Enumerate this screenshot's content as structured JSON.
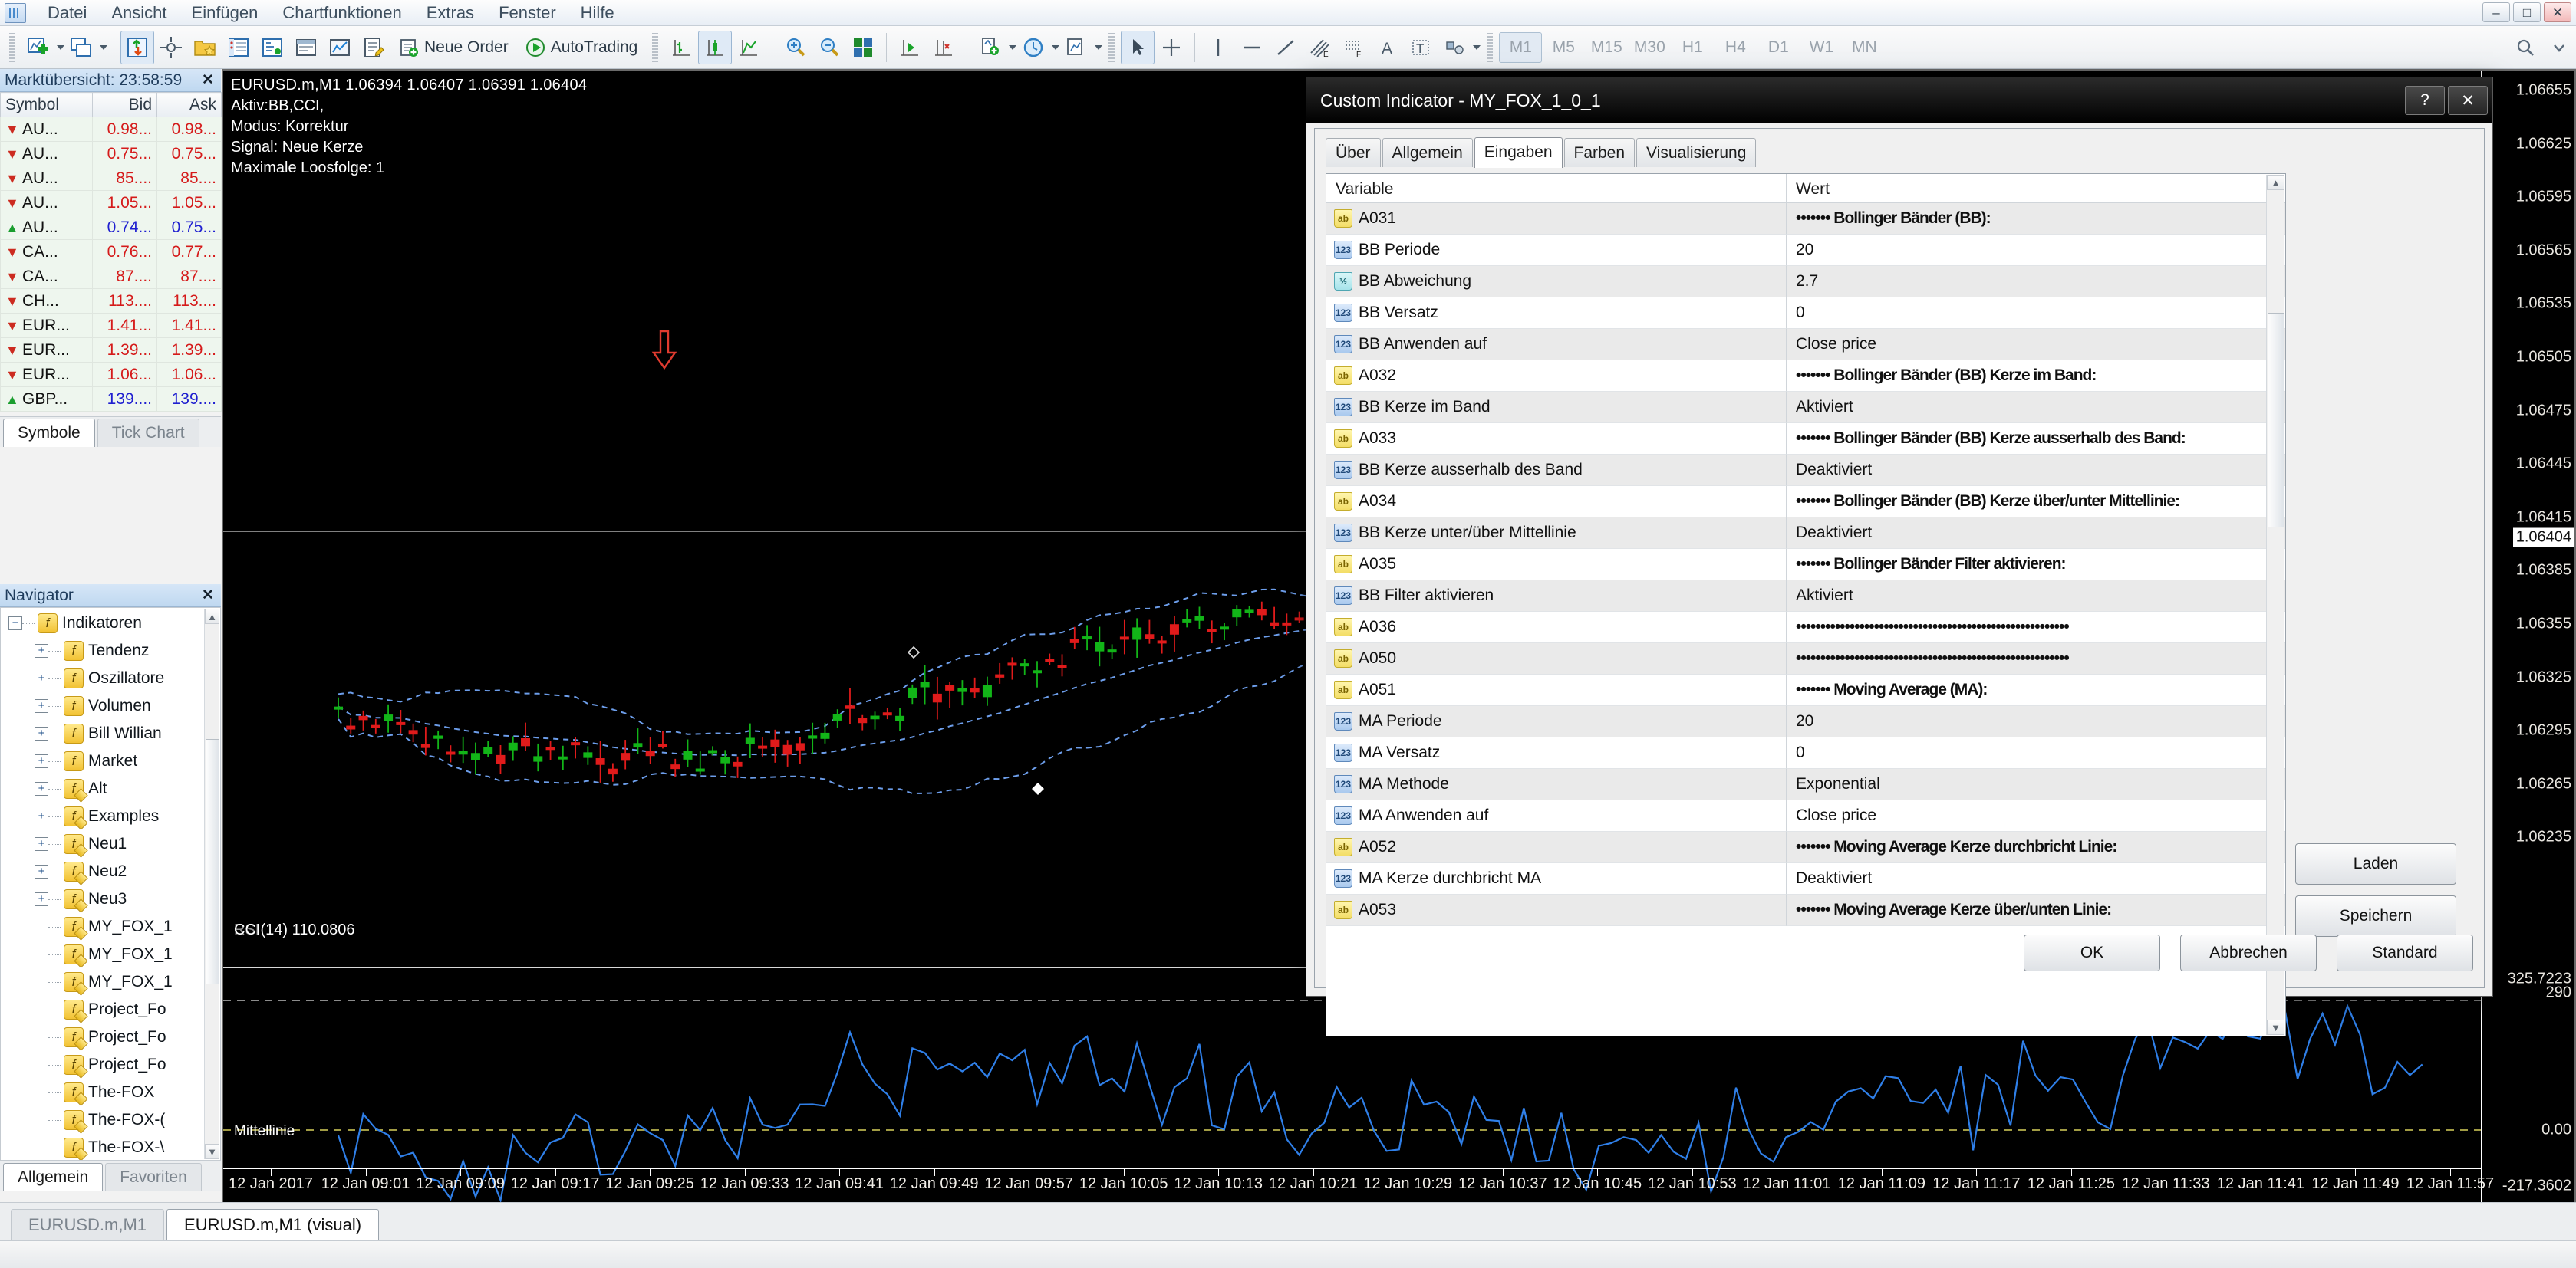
{
  "app": {
    "logo_icon": "metatrader-logo-icon",
    "menu": [
      "Datei",
      "Ansicht",
      "Einfügen",
      "Chartfunktionen",
      "Extras",
      "Fenster",
      "Hilfe"
    ],
    "window_buttons": [
      {
        "name": "minimize-button",
        "glyph": "–"
      },
      {
        "name": "maximize-button",
        "glyph": "□"
      },
      {
        "name": "close-button",
        "glyph": "✕"
      }
    ]
  },
  "toolbar": {
    "new_order_label": "Neue Order",
    "autotrading_label": "AutoTrading",
    "timeframes": [
      "M1",
      "M5",
      "M15",
      "M30",
      "H1",
      "H4",
      "D1",
      "W1",
      "MN"
    ],
    "active_timeframe": "M1",
    "icons": [
      "new-chart-icon",
      "chart-window-icon",
      "market-watch-icon",
      "crosshair-icon",
      "favorites-folder-icon",
      "data-window-icon",
      "navigator-icon",
      "terminal-icon",
      "strategy-tester-icon",
      "metaeditor-icon",
      "expert-advisors-icon",
      "bar-chart-icon",
      "candlestick-chart-icon",
      "line-chart-icon",
      "zoom-in-icon",
      "zoom-out-icon",
      "tile-windows-icon",
      "shift-end-icon",
      "auto-scroll-icon",
      "indicators-add-icon",
      "period-clock-icon",
      "template-icon",
      "cursor-icon",
      "crosshair-tool-icon",
      "vertical-line-icon",
      "horizontal-line-icon",
      "trendline-icon",
      "equidistant-channel-icon",
      "fibonacci-icon",
      "text-label-icon",
      "text-object-icon",
      "shapes-icon",
      "arrows-icon"
    ]
  },
  "market_watch": {
    "title": "Marktübersicht: 23:58:59",
    "close_icon": "close-icon",
    "columns": [
      "Symbol",
      "Bid",
      "Ask"
    ],
    "rows": [
      {
        "dir": "down",
        "symbol": "AU...",
        "bid": "0.98...",
        "ask": "0.98...",
        "tone": "down"
      },
      {
        "dir": "down",
        "symbol": "AU...",
        "bid": "0.75...",
        "ask": "0.75...",
        "tone": "down"
      },
      {
        "dir": "down",
        "symbol": "AU...",
        "bid": "85....",
        "ask": "85....",
        "tone": "down"
      },
      {
        "dir": "down",
        "symbol": "AU...",
        "bid": "1.05...",
        "ask": "1.05...",
        "tone": "down"
      },
      {
        "dir": "up",
        "symbol": "AU...",
        "bid": "0.74...",
        "ask": "0.75...",
        "tone": "up"
      },
      {
        "dir": "down",
        "symbol": "CA...",
        "bid": "0.76...",
        "ask": "0.77...",
        "tone": "down"
      },
      {
        "dir": "down",
        "symbol": "CA...",
        "bid": "87....",
        "ask": "87....",
        "tone": "down"
      },
      {
        "dir": "down",
        "symbol": "CH...",
        "bid": "113....",
        "ask": "113....",
        "tone": "down"
      },
      {
        "dir": "down",
        "symbol": "EUR...",
        "bid": "1.41...",
        "ask": "1.41...",
        "tone": "down"
      },
      {
        "dir": "down",
        "symbol": "EUR...",
        "bid": "1.39...",
        "ask": "1.39...",
        "tone": "down"
      },
      {
        "dir": "down",
        "symbol": "EUR...",
        "bid": "1.06...",
        "ask": "1.06...",
        "tone": "down"
      },
      {
        "dir": "up",
        "symbol": "GBP...",
        "bid": "139....",
        "ask": "139....",
        "tone": "up"
      }
    ],
    "tabs": [
      {
        "label": "Symbole",
        "active": true
      },
      {
        "label": "Tick Chart",
        "active": false
      }
    ]
  },
  "navigator": {
    "title": "Navigator",
    "close_icon": "close-icon",
    "items": [
      {
        "label": "Indikatoren",
        "depth": 0,
        "expander": "−",
        "custom": false
      },
      {
        "label": "Tendenz",
        "depth": 1,
        "expander": "+",
        "custom": false
      },
      {
        "label": "Oszillatore",
        "depth": 1,
        "expander": "+",
        "custom": false
      },
      {
        "label": "Volumen",
        "depth": 1,
        "expander": "+",
        "custom": false
      },
      {
        "label": "Bill Willian",
        "depth": 1,
        "expander": "+",
        "custom": false
      },
      {
        "label": "Market",
        "depth": 1,
        "expander": "+",
        "custom": false
      },
      {
        "label": "Alt",
        "depth": 1,
        "expander": "+",
        "custom": true
      },
      {
        "label": "Examples",
        "depth": 1,
        "expander": "+",
        "custom": true
      },
      {
        "label": "Neu1",
        "depth": 1,
        "expander": "+",
        "custom": true
      },
      {
        "label": "Neu2",
        "depth": 1,
        "expander": "+",
        "custom": true
      },
      {
        "label": "Neu3",
        "depth": 1,
        "expander": "+",
        "custom": true
      },
      {
        "label": "MY_FOX_1",
        "depth": 1,
        "expander": "",
        "custom": true
      },
      {
        "label": "MY_FOX_1",
        "depth": 1,
        "expander": "",
        "custom": true
      },
      {
        "label": "MY_FOX_1",
        "depth": 1,
        "expander": "",
        "custom": true
      },
      {
        "label": "Project_Fo",
        "depth": 1,
        "expander": "",
        "custom": true
      },
      {
        "label": "Project_Fo",
        "depth": 1,
        "expander": "",
        "custom": true
      },
      {
        "label": "Project_Fo",
        "depth": 1,
        "expander": "",
        "custom": true
      },
      {
        "label": "The-FOX",
        "depth": 1,
        "expander": "",
        "custom": true
      },
      {
        "label": "The-FOX-(",
        "depth": 1,
        "expander": "",
        "custom": true
      },
      {
        "label": "The-FOX-\\",
        "depth": 1,
        "expander": "",
        "custom": true
      }
    ],
    "tabs": [
      {
        "label": "Allgemein",
        "active": true
      },
      {
        "label": "Favoriten",
        "active": false
      }
    ]
  },
  "chart": {
    "header_line": "EURUSD.m,M1  1.06394 1.06407 1.06391 1.06404",
    "info_lines": [
      "Aktiv:BB,CCI,",
      "Modus: Korrektur",
      "Signal: Neue Kerze",
      "Maximale Loosfolge: 1"
    ],
    "cci_label": "CCI(14) 110.0806",
    "cci_overlap_label": "RSI",
    "mittellinie_label": "Mittellinie",
    "price_labels": [
      "1.06655",
      "1.06625",
      "1.06595",
      "1.06565",
      "1.06535",
      "1.06505",
      "1.06475",
      "1.06445",
      "1.06415",
      "1.06385",
      "1.06355",
      "1.06325",
      "1.06295",
      "1.06265",
      "1.06235"
    ],
    "current_price": "1.06404",
    "sub_axis_labels": [
      "325.7223",
      "290",
      "0.00",
      "-217.3602"
    ],
    "time_labels": [
      "12 Jan 2017",
      "12 Jan 09:01",
      "12 Jan 09:09",
      "12 Jan 09:17",
      "12 Jan 09:25",
      "12 Jan 09:33",
      "12 Jan 09:41",
      "12 Jan 09:49",
      "12 Jan 09:57",
      "12 Jan 10:05",
      "12 Jan 10:13",
      "12 Jan 10:21",
      "12 Jan 10:29",
      "12 Jan 10:37",
      "12 Jan 10:45",
      "12 Jan 10:53",
      "12 Jan 11:01",
      "12 Jan 11:09",
      "12 Jan 11:17",
      "12 Jan 11:25",
      "12 Jan 11:33",
      "12 Jan 11:41",
      "12 Jan 11:49",
      "12 Jan 11:57"
    ],
    "colors": {
      "background": "#000000",
      "bull_candle": "#12b518",
      "bear_candle": "#e01b1b",
      "bollinger_band": "#6d9eeb",
      "cci_line": "#2f7fe8",
      "level_line": "#cccccc"
    }
  },
  "dialog": {
    "title": "Custom Indicator - MY_FOX_1_0_1",
    "help_glyph": "?",
    "close_glyph": "✕",
    "tabs": [
      {
        "label": "Über",
        "active": false
      },
      {
        "label": "Allgemein",
        "active": false
      },
      {
        "label": "Eingaben",
        "active": true
      },
      {
        "label": "Farben",
        "active": false
      },
      {
        "label": "Visualisierung",
        "active": false
      }
    ],
    "grid": {
      "columns": [
        "Variable",
        "Wert"
      ],
      "rows": [
        {
          "icon": "ab",
          "variable": "A031",
          "value": "••••••• Bollinger Bänder (BB):",
          "stars": true
        },
        {
          "icon": "123",
          "variable": "BB Periode",
          "value": "20"
        },
        {
          "icon": "12",
          "variable": "BB Abweichung",
          "value": "2.7"
        },
        {
          "icon": "123",
          "variable": "BB Versatz",
          "value": "0"
        },
        {
          "icon": "123",
          "variable": "BB Anwenden auf",
          "value": "Close price"
        },
        {
          "icon": "ab",
          "variable": "A032",
          "value": "••••••• Bollinger Bänder (BB) Kerze im Band:",
          "stars": true
        },
        {
          "icon": "123",
          "variable": "BB Kerze im Band",
          "value": "Aktiviert"
        },
        {
          "icon": "ab",
          "variable": "A033",
          "value": "••••••• Bollinger Bänder (BB) Kerze ausserhalb des Band:",
          "stars": true
        },
        {
          "icon": "123",
          "variable": "BB Kerze ausserhalb des Band",
          "value": "Deaktiviert"
        },
        {
          "icon": "ab",
          "variable": "A034",
          "value": "••••••• Bollinger Bänder (BB) Kerze über/unter Mittellinie:",
          "stars": true
        },
        {
          "icon": "123",
          "variable": "BB Kerze unter/über Mittellinie",
          "value": "Deaktiviert"
        },
        {
          "icon": "ab",
          "variable": "A035",
          "value": "••••••• Bollinger Bänder Filter aktivieren:",
          "stars": true
        },
        {
          "icon": "123",
          "variable": "BB Filter aktivieren",
          "value": "Aktiviert"
        },
        {
          "icon": "ab",
          "variable": "A036",
          "value": "••••••••••••••••••••••••••••••••••••••••••••••••••••••••",
          "stars": true,
          "ellipsis": "..."
        },
        {
          "icon": "ab",
          "variable": "A050",
          "value": "••••••••••••••••••••••••••••••••••••••••••••••••••••••••",
          "stars": true,
          "ellipsis": "..."
        },
        {
          "icon": "ab",
          "variable": "A051",
          "value": "••••••• Moving Average (MA):",
          "stars": true
        },
        {
          "icon": "123",
          "variable": "MA Periode",
          "value": "20"
        },
        {
          "icon": "123",
          "variable": "MA Versatz",
          "value": "0"
        },
        {
          "icon": "123",
          "variable": "MA Methode",
          "value": "Exponential"
        },
        {
          "icon": "123",
          "variable": "MA Anwenden auf",
          "value": "Close price"
        },
        {
          "icon": "ab",
          "variable": "A052",
          "value": "••••••• Moving Average Kerze durchbricht Linie:",
          "stars": true
        },
        {
          "icon": "123",
          "variable": "MA Kerze durchbricht MA",
          "value": "Deaktiviert"
        },
        {
          "icon": "ab",
          "variable": "A053",
          "value": "••••••• Moving Average Kerze über/unten Linie:",
          "stars": true
        }
      ]
    },
    "side_buttons": [
      {
        "label": "Laden",
        "name": "load-button"
      },
      {
        "label": "Speichern",
        "name": "save-button"
      }
    ],
    "footer_buttons": [
      {
        "label": "OK",
        "name": "ok-button"
      },
      {
        "label": "Abbrechen",
        "name": "cancel-button"
      },
      {
        "label": "Standard",
        "name": "default-button"
      }
    ]
  },
  "bottom_tabs": [
    {
      "label": "EURUSD.m,M1",
      "active": false
    },
    {
      "label": "EURUSD.m,M1 (visual)",
      "active": true
    }
  ]
}
